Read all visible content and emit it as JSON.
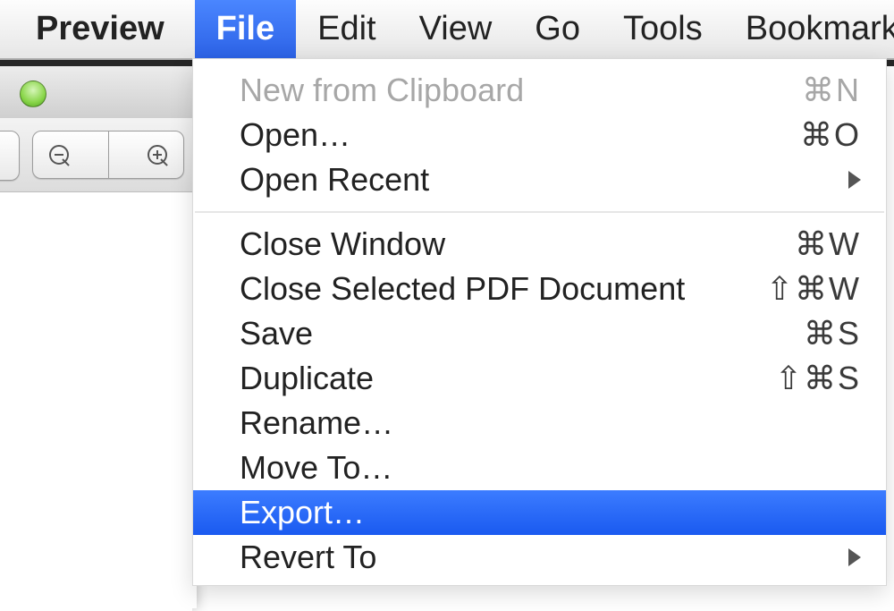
{
  "menubar": {
    "app": "Preview",
    "items": [
      "File",
      "Edit",
      "View",
      "Go",
      "Tools",
      "Bookmarks"
    ],
    "open_index": 0
  },
  "file_menu": {
    "groups": [
      [
        {
          "label": "New from Clipboard",
          "shortcut": "⌘N",
          "disabled": true
        },
        {
          "label": "Open…",
          "shortcut": "⌘O"
        },
        {
          "label": "Open Recent",
          "submenu": true
        }
      ],
      [
        {
          "label": "Close Window",
          "shortcut": "⌘W"
        },
        {
          "label": "Close Selected PDF Document",
          "shortcut": "⇧⌘W"
        },
        {
          "label": "Save",
          "shortcut": "⌘S"
        },
        {
          "label": "Duplicate",
          "shortcut": "⇧⌘S"
        },
        {
          "label": "Rename…"
        },
        {
          "label": "Move To…"
        },
        {
          "label": "Export…",
          "selected": true
        },
        {
          "label": "Revert To",
          "submenu": true
        }
      ]
    ]
  },
  "toolbar": {
    "zoom_out": "zoom-out",
    "zoom_in": "zoom-in"
  }
}
